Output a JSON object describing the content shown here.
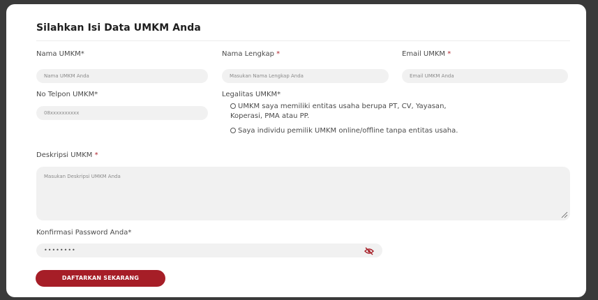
{
  "form": {
    "title": "Silahkan Isi Data UMKM Anda",
    "nama_umkm": {
      "label": "Nama UMKM",
      "req": "*",
      "placeholder": "Nama UMKM Anda"
    },
    "nama_lengkap": {
      "label": "Nama Lengkap ",
      "req": "*",
      "placeholder": "Masukan Nama Lengkap Anda"
    },
    "email": {
      "label": "Email UMKM ",
      "req": "*",
      "placeholder": "Email UMKM Anda"
    },
    "telpon": {
      "label": "No Telpon UMKM",
      "req": "*",
      "placeholder": "08xxxxxxxxxx"
    },
    "legalitas": {
      "label": "Legalitas UMKM",
      "req": "*",
      "options": [
        "UMKM saya memiliki entitas usaha berupa PT, CV, Yayasan,",
        "Koperasi, PMA atau PP.",
        "Saya individu pemilik UMKM online/offline tanpa entitas usaha."
      ]
    },
    "deskripsi": {
      "label": "Deskripsi UMKM ",
      "req": "*",
      "placeholder": "Masukan Deskripsi UMKM Anda"
    },
    "password": {
      "label": "Konfirmasi Password Anda",
      "req": "*",
      "value": "••••••••"
    },
    "submit_label": "DAFTARKAN SEKARANG"
  },
  "colors": {
    "accent": "#a61e27",
    "field_bg": "#f1f1f1"
  },
  "icons": {
    "password_toggle": "eye-slash-icon",
    "resize": "resize-handle-icon"
  }
}
